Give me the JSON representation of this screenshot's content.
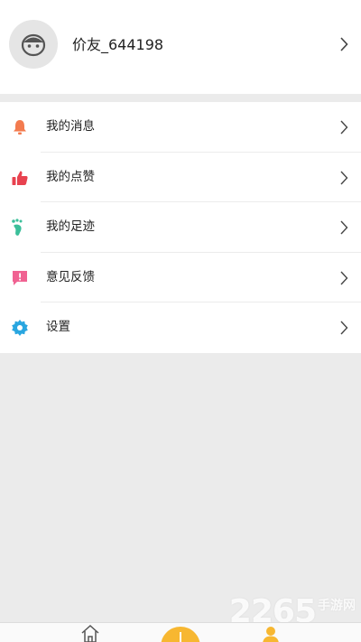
{
  "profile": {
    "username": "价友_644198",
    "avatar_icon": "avatar-face-icon",
    "chevron_icon": "chevron-right-icon"
  },
  "menu": {
    "items": [
      {
        "label": "我的消息",
        "icon": "bell-icon",
        "color": "#f37b4f"
      },
      {
        "label": "我的点赞",
        "icon": "thumbs-up-icon",
        "color": "#e8424f"
      },
      {
        "label": "我的足迹",
        "icon": "footprint-icon",
        "color": "#3bbf9a"
      },
      {
        "label": "意见反馈",
        "icon": "feedback-icon",
        "color": "#f06292"
      },
      {
        "label": "设置",
        "icon": "settings-gear-icon",
        "color": "#29a6e0"
      }
    ]
  },
  "tabbar": {
    "tabs": [
      {
        "icon": "home-icon"
      },
      {
        "icon": "add-post-icon",
        "color": "#f7b731"
      },
      {
        "icon": "user-icon",
        "color": "#f7b731"
      }
    ]
  },
  "watermark": {
    "number": "2265",
    "site": "手游网"
  }
}
